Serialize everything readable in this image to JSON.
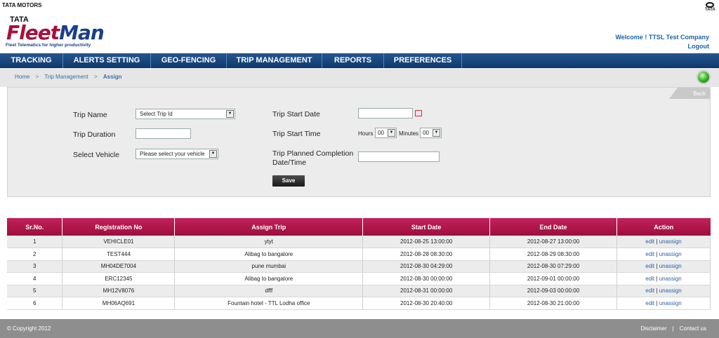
{
  "brand": {
    "top_label": "TATA MOTORS",
    "corner_label": "TATA",
    "logo_tata": "TATA",
    "logo_fleet": "Fleet",
    "logo_man": "Man",
    "tagline": "Fleet Telematics for higher productivity"
  },
  "user": {
    "welcome": "Welcome ! TTSL Test Company",
    "logout": "Logout"
  },
  "nav": {
    "items": [
      {
        "label": "TRACKING"
      },
      {
        "label": "ALERTS SETTING"
      },
      {
        "label": "GEO-FENCING"
      },
      {
        "label": "TRIP MANAGEMENT"
      },
      {
        "label": "REPORTS"
      },
      {
        "label": "PREFERENCES"
      }
    ]
  },
  "breadcrumb": {
    "home": "Home",
    "sep1": ">",
    "parent": "Trip Management",
    "sep2": ">",
    "current": "Assign"
  },
  "form": {
    "back": "Back",
    "trip_name_label": "Trip Name",
    "trip_name_value": "Select Trip Id",
    "trip_duration_label": "Trip Duration",
    "trip_duration_value": "",
    "select_vehicle_label": "Select Vehicle",
    "select_vehicle_value": "Please select your vehicle",
    "trip_start_date_label": "Trip Start Date",
    "trip_start_date_value": "",
    "trip_start_time_label": "Trip Start Time",
    "hours_label": "Hours",
    "hours_value": "00",
    "minutes_label": "Minutes",
    "minutes_value": "00",
    "planned_completion_label_1": "Trip Planned Completion",
    "planned_completion_label_2": "Date/Time",
    "planned_completion_value": "",
    "save": "Save"
  },
  "table": {
    "headers": [
      "Sr.No.",
      "Registration No",
      "Assign Trip",
      "Start Date",
      "End Date",
      "Action"
    ],
    "rows": [
      {
        "sr": "1",
        "reg": "VEHICLE01",
        "trip": "ytyt",
        "start": "2012-08-25 13:00:00",
        "end": "2012-08-27 13:00:00",
        "edit": "edit",
        "sep": "|",
        "unassign": "unassign"
      },
      {
        "sr": "2",
        "reg": "TEST444",
        "trip": "Alibag to bangalore",
        "start": "2012-08-28 08:30:00",
        "end": "2012-08-29 08:30:00",
        "edit": "edit",
        "sep": "|",
        "unassign": "unassign"
      },
      {
        "sr": "3",
        "reg": "MH04DE7004",
        "trip": "pune mumbai",
        "start": "2012-08-30 04:29:00",
        "end": "2012-08-30 07:29:00",
        "edit": "edit",
        "sep": "|",
        "unassign": "unassign"
      },
      {
        "sr": "4",
        "reg": "ERC12345",
        "trip": "Alibag to bangalore",
        "start": "2012-08-30 00:00:00",
        "end": "2012-09-01 00:00:00",
        "edit": "edit",
        "sep": "|",
        "unassign": "unassign"
      },
      {
        "sr": "5",
        "reg": "MH12V8076",
        "trip": "dfff",
        "start": "2012-08-31 00:00:00",
        "end": "2012-09-03 00:00:00",
        "edit": "edit",
        "sep": "|",
        "unassign": "unassign"
      },
      {
        "sr": "6",
        "reg": "MH06AQ691",
        "trip": "Fountain hotel - TTL Lodha office",
        "start": "2012-08-30 20:40:00",
        "end": "2012-08-30 21:00:00",
        "edit": "edit",
        "sep": "|",
        "unassign": "unassign"
      }
    ]
  },
  "footer": {
    "copyright": "© Copyright 2012",
    "disclaimer": "Disclaimer",
    "contact": "Contact us"
  },
  "colors": {
    "nav": "#1a4a82",
    "table_header": "#b0184b",
    "status": "#2fae1f"
  }
}
